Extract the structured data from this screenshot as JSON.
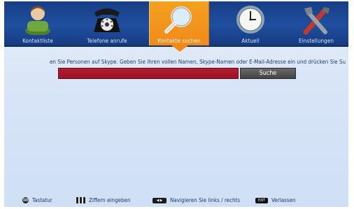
{
  "nav": {
    "items": [
      {
        "label": "Kontaktliste",
        "icon": "contact-person-icon"
      },
      {
        "label": "Telefone anrufe",
        "icon": "rotary-phone-icon"
      },
      {
        "label": "Kontakte suchen",
        "icon": "magnifier-icon",
        "active": true
      },
      {
        "label": "Aktuell",
        "icon": "clock-icon"
      },
      {
        "label": "Einstellungen",
        "icon": "tools-icon"
      }
    ]
  },
  "main": {
    "instruction": "en Sie Personen auf Skype. Geben Sie ihren vollen Namen, Skype-Namen oder E-Mail-Adresse ein und drücken Sie Su",
    "search_value": "",
    "search_button": "Suche"
  },
  "footer": {
    "hints": [
      {
        "label": "Tastatur",
        "key": "keyboard-key-icon"
      },
      {
        "label": "Ziffern eingeben",
        "key": "number-keys-icon"
      },
      {
        "label": "Navigieren Sie links / rechts",
        "key": "left-right-keys-icon"
      },
      {
        "label": "Verlassen",
        "key": "exit-key-icon",
        "key_text": "EXIT"
      }
    ]
  },
  "colors": {
    "topbar": "#1f4f9f",
    "active_tab": "#f28a1a",
    "search_field": "#b51b2f",
    "button": "#4a4a4a",
    "background": "#d8e5f7"
  }
}
